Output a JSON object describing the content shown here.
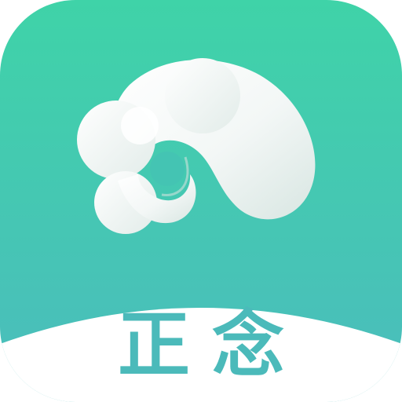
{
  "app": {
    "name": "正念",
    "logo_icon": "cloud-swirl-icon"
  },
  "colors": {
    "gradient_top": "#3fd3a8",
    "gradient_bottom": "#4bbcbd",
    "cloud_white": "#ffffff",
    "cloud_shadow": "#dfe9e6",
    "text": "#4bbaba",
    "base_band": "#ffffff"
  }
}
